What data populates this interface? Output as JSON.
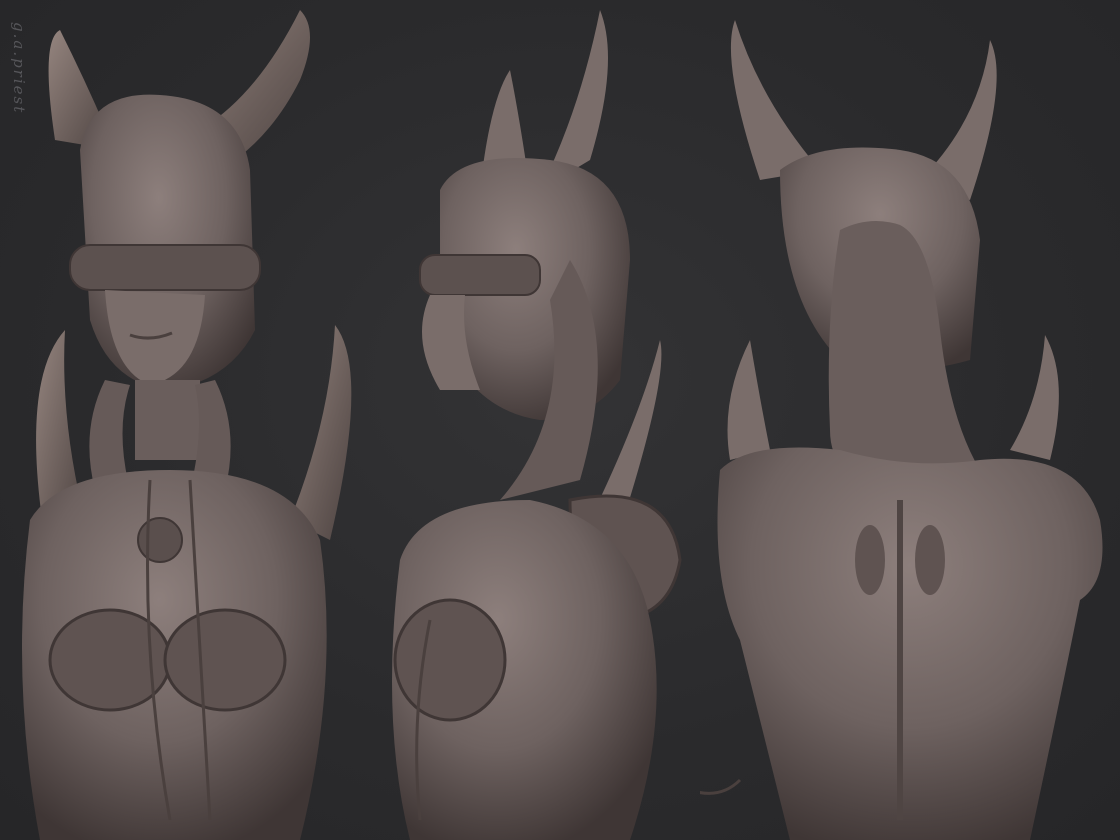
{
  "signature": {
    "text": "g.a.priest"
  },
  "views": [
    {
      "id": "front",
      "label": ""
    },
    {
      "id": "side",
      "label": ""
    },
    {
      "id": "back",
      "label": ""
    }
  ],
  "colors": {
    "background": "#2b2b2d",
    "clay": "#6e6260",
    "clay_light": "#8d7f7c",
    "clay_dark": "#3f3635",
    "signature": "#56565a"
  }
}
